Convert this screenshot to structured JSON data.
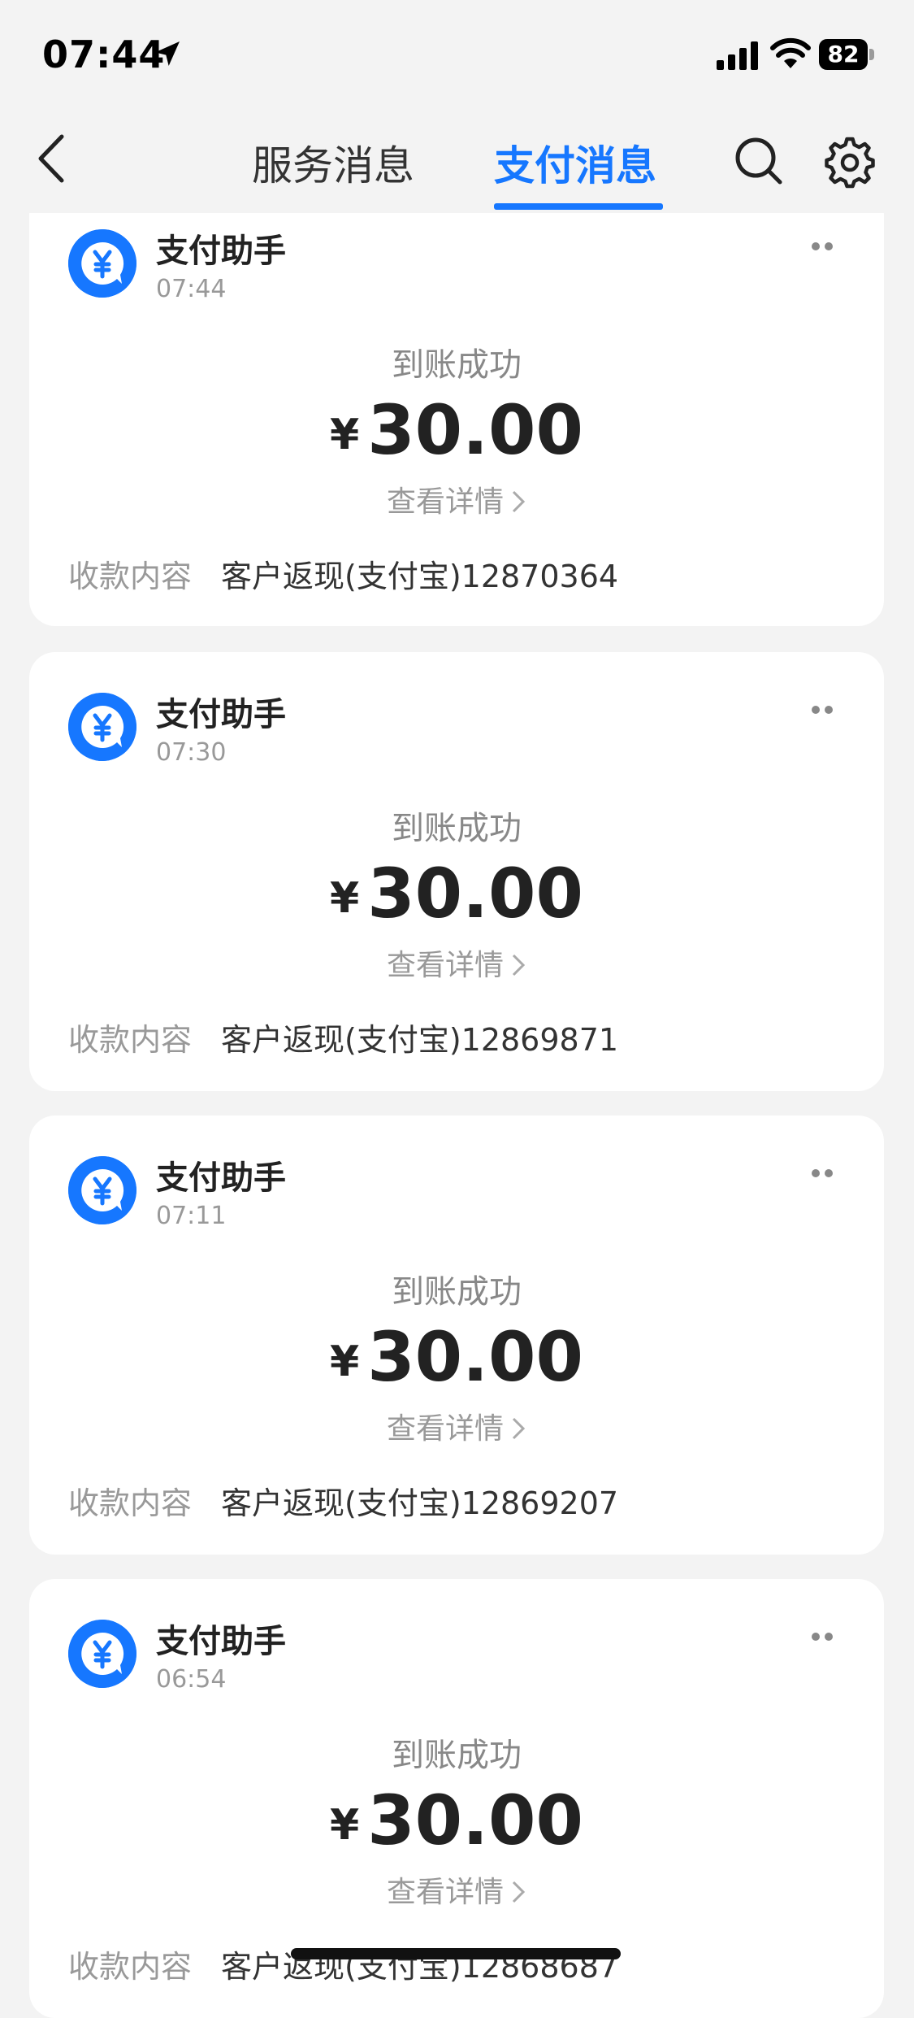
{
  "status_bar": {
    "time": "07:44",
    "battery": "82"
  },
  "nav": {
    "tabs": [
      {
        "label": "服务消息",
        "active": false
      },
      {
        "label": "支付消息",
        "active": true
      }
    ]
  },
  "colors": {
    "accent": "#1677ff",
    "background": "#f3f3f3",
    "card": "#ffffff"
  },
  "cards": [
    {
      "title": "支付助手",
      "time": "07:44",
      "status": "到账成功",
      "currency": "¥",
      "amount": "30.00",
      "detail": "查看详情",
      "content_label": "收款内容",
      "content": "客户返现(支付宝)12870364"
    },
    {
      "title": "支付助手",
      "time": "07:30",
      "status": "到账成功",
      "currency": "¥",
      "amount": "30.00",
      "detail": "查看详情",
      "content_label": "收款内容",
      "content": "客户返现(支付宝)12869871"
    },
    {
      "title": "支付助手",
      "time": "07:11",
      "status": "到账成功",
      "currency": "¥",
      "amount": "30.00",
      "detail": "查看详情",
      "content_label": "收款内容",
      "content": "客户返现(支付宝)12869207"
    },
    {
      "title": "支付助手",
      "time": "06:54",
      "status": "到账成功",
      "currency": "¥",
      "amount": "30.00",
      "detail": "查看详情",
      "content_label": "收款内容",
      "content": "客户返现(支付宝)12868687"
    }
  ],
  "icons": [
    "location-arrow-icon",
    "signal-icon",
    "wifi-icon",
    "battery-icon",
    "back-icon",
    "search-icon",
    "gear-icon",
    "yen-avatar-icon",
    "more-icon",
    "chevron-right-icon"
  ]
}
